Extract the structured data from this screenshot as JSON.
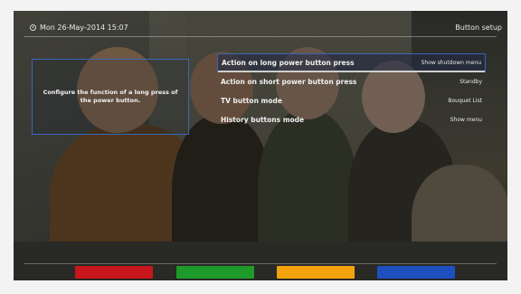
{
  "header": {
    "datetime": "Mon 26-May-2014 15:07",
    "screen_title": "Button setup"
  },
  "description": "Configure the function of a long press of the power button.",
  "menu": {
    "items": [
      {
        "label": "Action on long power button press",
        "value": "Show shutdown menu",
        "selected": true
      },
      {
        "label": "Action on short power button press",
        "value": "Standby",
        "selected": false
      },
      {
        "label": "TV button mode",
        "value": "Bouquet List",
        "selected": false
      },
      {
        "label": "History buttons mode",
        "value": "Show menu",
        "selected": false
      }
    ]
  },
  "color_buttons": {
    "red": "",
    "green": "",
    "yellow": "",
    "blue": ""
  },
  "colors": {
    "accent_border": "#3a67b6",
    "red": "#c8161c",
    "green": "#1e9a2a",
    "yellow": "#f1a20d",
    "blue": "#1e4fbf"
  }
}
